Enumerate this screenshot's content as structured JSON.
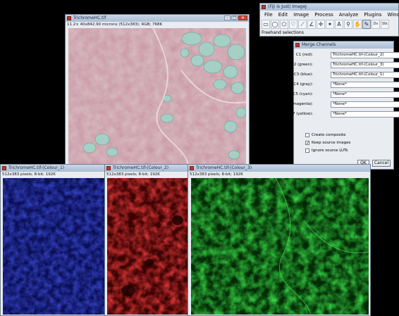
{
  "histo_window": {
    "title": "TrichromeHC.tif",
    "info": "11.2× 40x842.90 microns (512x383); RGB; 768K"
  },
  "imagej": {
    "title": "(Fiji Is Just) ImageJ",
    "menus": [
      "File",
      "Edit",
      "Image",
      "Process",
      "Analyze",
      "Plugins",
      "Window"
    ],
    "tools": [
      "rectangle-tool-icon",
      "oval-tool-icon",
      "polygon-tool-icon",
      "freehand-tool-icon",
      "line-tool-icon",
      "angle-tool-icon",
      "point-tool-icon",
      "wand-tool-icon",
      "text-tool-icon",
      "magnifier-tool-icon",
      "hand-tool-icon",
      "color-picker-icon",
      "dev-tool-icon",
      "stk-tool-icon"
    ],
    "tool_glyphs": [
      "▭",
      "◯",
      "⬠",
      "♡",
      "⟋",
      "∠",
      "✛",
      "✶",
      "A",
      "⚲",
      "✋",
      "✎",
      "Dv",
      "Stk"
    ],
    "status": "Freehand selections"
  },
  "merge_dialog": {
    "title": "Merge Channels",
    "channels": [
      {
        "label": "C1 (red):",
        "value": "TrichromeHC.tif-(Colour_2)"
      },
      {
        "label": "C2 (green):",
        "value": "TrichromeHC.tif-(Colour_3)"
      },
      {
        "label": "C3 (blue):",
        "value": "TrichromeHC.tif-(Colour_1)"
      },
      {
        "label": "C4 (gray):",
        "value": "*None*"
      },
      {
        "label": "C5 (cyan):",
        "value": "*None*"
      },
      {
        "label": "C6 (magenta):",
        "value": "*None*"
      },
      {
        "label": "C7 (yellow):",
        "value": "*None*"
      }
    ],
    "options": [
      {
        "label": "Create composite",
        "checked": false
      },
      {
        "label": "Keep source images",
        "checked": true
      },
      {
        "label": "Ignore source LUTs",
        "checked": false
      }
    ],
    "ok_label": "OK",
    "cancel_label": "Cancel"
  },
  "channel_windows": [
    {
      "title": "TrichromeHC.tif-(Colour_1)",
      "info": "512x383 pixels; 8-bit; 192K",
      "color": "#1a2bd8"
    },
    {
      "title": "TrichromeHC.tif-(Colour_2)",
      "info": "512x383 pixels; 8-bit; 192K",
      "color": "#e01a1a"
    },
    {
      "title": "TrichromeHC.tif-(Colour_3)",
      "info": "512x383 pixels; 8-bit; 192K",
      "color": "#1fb520"
    }
  ]
}
